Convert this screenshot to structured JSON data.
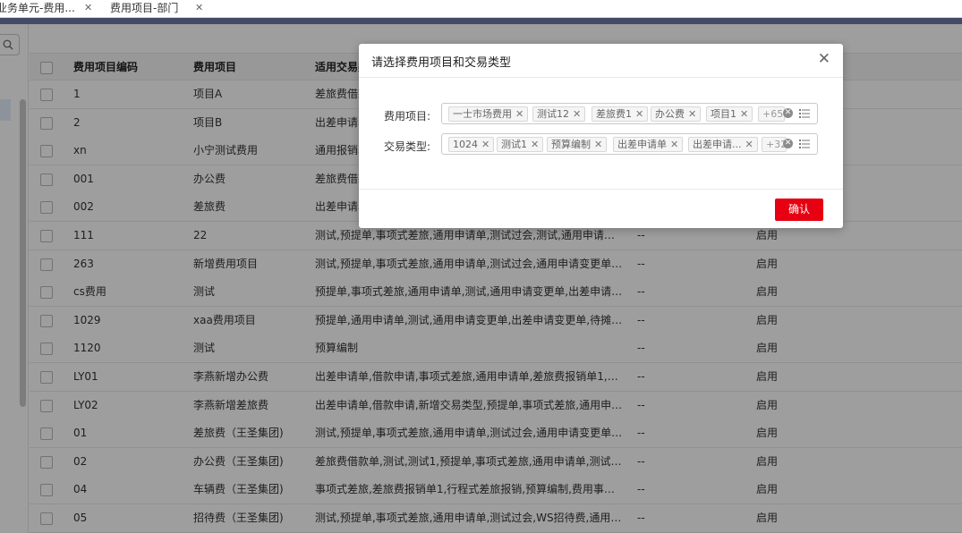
{
  "tabs": [
    {
      "label": "业务单元-费用..."
    },
    {
      "label": "费用项目-部门"
    }
  ],
  "table": {
    "headers": {
      "code": "费用项目编码",
      "name": "费用项目",
      "types": "适用交易类"
    },
    "rows": [
      {
        "code": "1",
        "name": "项目A",
        "types": "差旅费借款",
        "dash": "",
        "status": ""
      },
      {
        "code": "2",
        "name": "项目B",
        "types": "出差申请单",
        "dash": "",
        "status": ""
      },
      {
        "code": "xn",
        "name": "小宁测试费用",
        "types": "通用报销单",
        "dash": "",
        "status": ""
      },
      {
        "code": "001",
        "name": "办公费",
        "types": "差旅费借款",
        "dash": "",
        "status": ""
      },
      {
        "code": "002",
        "name": "差旅费",
        "types": "出差申请单",
        "dash": "",
        "status": ""
      },
      {
        "code": "111",
        "name": "22",
        "types": "测试,预提单,事项式差旅,通用申请单,测试过会,测试,通用申请变更...",
        "dash": "--",
        "status": "启用"
      },
      {
        "code": "263",
        "name": "新增费用项目",
        "types": "测试,预提单,事项式差旅,通用申请单,测试过会,通用申请变更单,出...",
        "dash": "--",
        "status": "启用"
      },
      {
        "code": "cs费用",
        "name": "测试",
        "types": "预提单,事项式差旅,通用申请单,测试,通用申请变更单,出差申请变...",
        "dash": "--",
        "status": "启用"
      },
      {
        "code": "1029",
        "name": "xaa费用项目",
        "types": "预提单,通用申请单,测试,通用申请变更单,出差申请变更单,待摊费...",
        "dash": "--",
        "status": "启用"
      },
      {
        "code": "1120",
        "name": "测试",
        "types": "预算编制",
        "dash": "--",
        "status": "启用"
      },
      {
        "code": "LY01",
        "name": "李燕新增办公费",
        "types": "出差申请单,借款申请,事项式差旅,通用申请单,差旅费报销单1,对...",
        "dash": "--",
        "status": "启用"
      },
      {
        "code": "LY02",
        "name": "李燕新增差旅费",
        "types": "出差申请单,借款申请,新增交易类型,预提单,事项式差旅,通用申请...",
        "dash": "--",
        "status": "启用"
      },
      {
        "code": "01",
        "name": "差旅费（王圣集团)",
        "types": "测试,预提单,事项式差旅,通用申请单,测试过会,通用申请变更单,出...",
        "dash": "--",
        "status": "启用"
      },
      {
        "code": "02",
        "name": "办公费（王圣集团)",
        "types": "差旅费借款单,测试,测试1,预提单,事项式差旅,通用申请单,测试过...",
        "dash": "--",
        "status": "启用"
      },
      {
        "code": "04",
        "name": "车辆费（王圣集团)",
        "types": "事项式差旅,差旅费报销单1,行程式差旅报销,预算编制,费用事项式...",
        "dash": "--",
        "status": "启用"
      },
      {
        "code": "05",
        "name": "招待费（王圣集团)",
        "types": "测试,预提单,事项式差旅,通用申请单,测试过会,WS招待费,通用申...",
        "dash": "--",
        "status": "启用"
      }
    ]
  },
  "modal": {
    "title": "请选择费用项目和交易类型",
    "expense_label": "费用项目:",
    "expense_tags": [
      "一士市场费用",
      "测试12",
      "差旅费1",
      "办公费",
      "项目1"
    ],
    "expense_more": "+65",
    "type_label": "交易类型:",
    "type_tags": [
      "1024",
      "测试1",
      "预算编制",
      "出差申请单",
      "出差申请..."
    ],
    "type_more": "+32",
    "confirm_label": "确认"
  },
  "colors": {
    "topbar": "#454b66",
    "confirm": "#e60012",
    "overlay": "rgba(0,0,0,0.38)"
  },
  "icons": {
    "search": "search-icon",
    "close": "close-icon",
    "clear": "clear-circle-icon",
    "list": "list-icon"
  }
}
